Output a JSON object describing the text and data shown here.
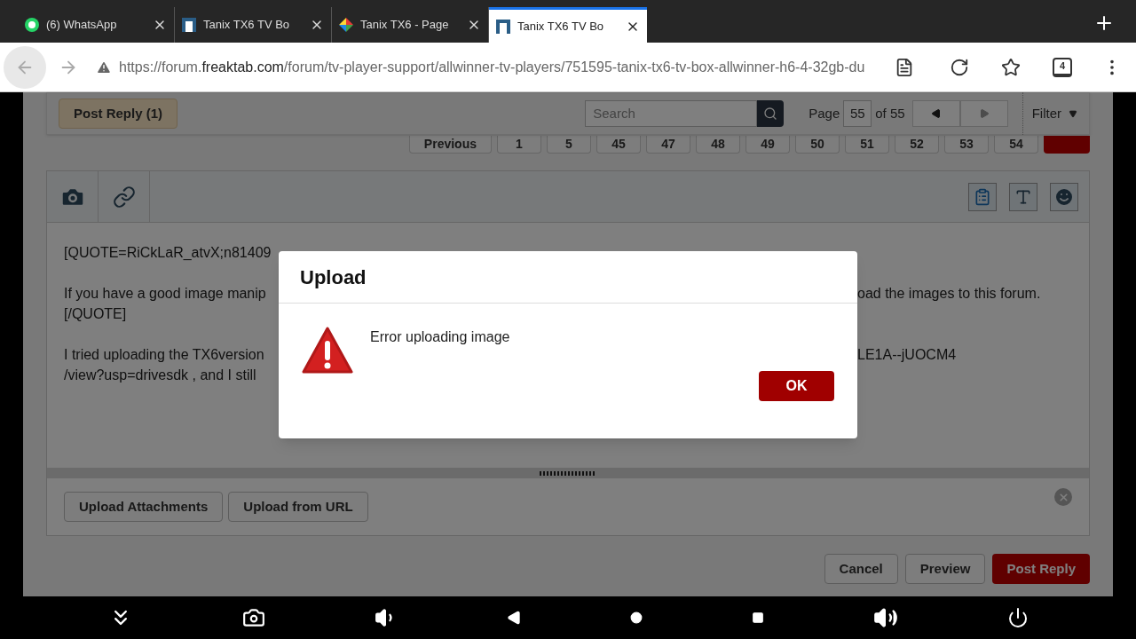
{
  "browser": {
    "tabs": [
      {
        "title": "(6) WhatsApp",
        "selected": false,
        "kind": "whatsapp"
      },
      {
        "title": "Tanix TX6 TV Bo",
        "selected": false,
        "kind": "forum"
      },
      {
        "title": "Tanix TX6 - Page",
        "selected": false,
        "kind": "colorful"
      },
      {
        "title": "Tanix TX6 TV Bo",
        "selected": true,
        "kind": "forum"
      }
    ],
    "url": {
      "prefix": "https://forum.",
      "domain": "freaktab.com",
      "path": "/forum/tv-player-support/allwinner-tv-players/751595-tanix-tx6-tv-box-allwinner-h6-4-32gb-du"
    },
    "tab_count": "4"
  },
  "toolbar": {
    "post_reply": "Post Reply (1)",
    "search_placeholder": "Search",
    "page_label": "Page",
    "page_value": "55",
    "page_of": "of 55",
    "filter": "Filter"
  },
  "pagination": [
    {
      "label": "Previous",
      "selected": false
    },
    {
      "label": "1",
      "selected": false
    },
    {
      "label": "5",
      "selected": false
    },
    {
      "label": "45",
      "selected": false
    },
    {
      "label": "47",
      "selected": false
    },
    {
      "label": "48",
      "selected": false
    },
    {
      "label": "49",
      "selected": false
    },
    {
      "label": "50",
      "selected": false
    },
    {
      "label": "51",
      "selected": false
    },
    {
      "label": "52",
      "selected": false
    },
    {
      "label": "53",
      "selected": false
    },
    {
      "label": "54",
      "selected": false
    },
    {
      "selected": true
    }
  ],
  "editor": {
    "paragraphs": [
      [
        {
          "left": "[QUOTE=RiCkLaR_atvX;n81409"
        }
      ],
      [
        {
          "left": "If you have a good image manip",
          "right": "oad the images to this forum."
        },
        {
          "left": "[/QUOTE]"
        }
      ],
      [
        {
          "left": "I tried uploading the TX6version",
          "right": "LE1A--jUOCM4"
        },
        {
          "left": "/view?usp=drivesdk , and I still"
        }
      ]
    ]
  },
  "attachments": [
    "Upload Attachments",
    "Upload from URL"
  ],
  "actions": [
    "Cancel",
    "Preview",
    "Post Reply"
  ],
  "dialog": {
    "title": "Upload",
    "message": "Error uploading image",
    "ok": "OK"
  }
}
